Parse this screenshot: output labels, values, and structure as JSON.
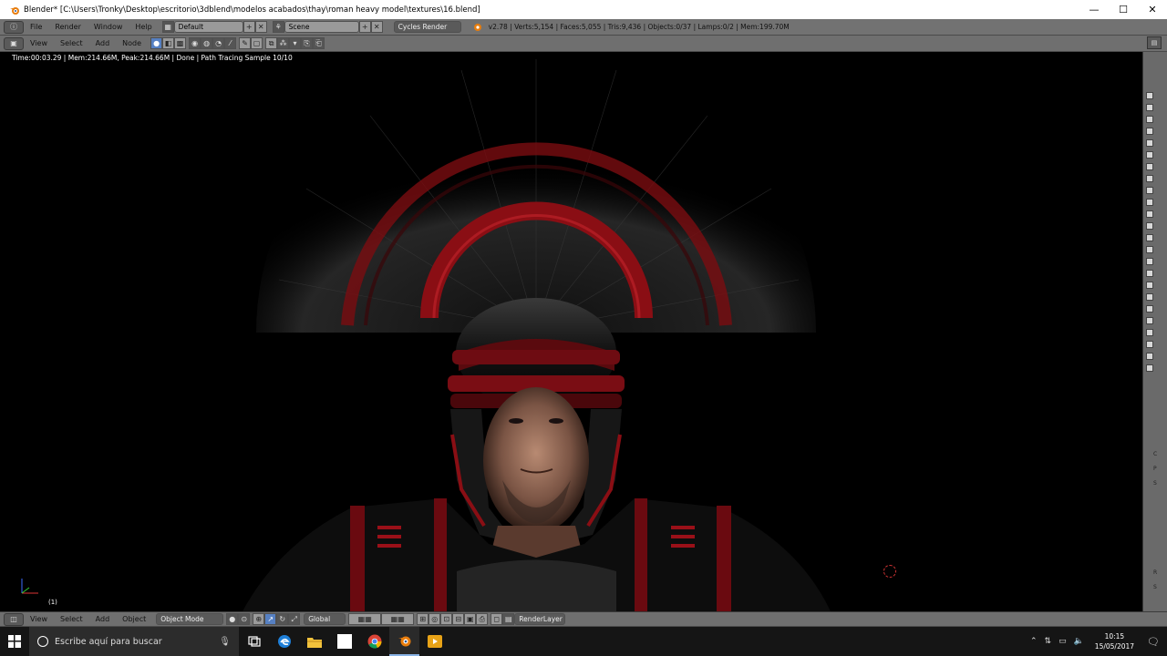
{
  "window": {
    "title": "Blender* [C:\\Users\\Tronky\\Desktop\\escritorio\\3dblend\\modelos acabados\\thay\\roman heavy model\\textures\\16.blend]",
    "minimize": "—",
    "maximize": "☐",
    "close": "✕"
  },
  "info_bar": {
    "menus": [
      "File",
      "Render",
      "Window",
      "Help"
    ],
    "screen_layout": "Default",
    "scene": "Scene",
    "engine": "Cycles Render",
    "stats": "v2.78 | Verts:5,154 | Faces:5,055 | Tris:9,436 | Objects:0/37 | Lamps:0/2 | Mem:199.70M"
  },
  "node_header": {
    "menus": [
      "View",
      "Select",
      "Add",
      "Node"
    ]
  },
  "viewport": {
    "render_status": "Time:00:03.29 | Mem:214.66M, Peak:214.66M | Done | Path Tracing Sample 10/10",
    "frame": "(1)"
  },
  "bottom_header": {
    "menus": [
      "View",
      "Select",
      "Add",
      "Object"
    ],
    "mode": "Object Mode",
    "orientation": "Global",
    "render_layer": "RenderLayer"
  },
  "side_panel": {
    "labels": [
      "C",
      "P",
      "S",
      "R",
      "S"
    ]
  },
  "taskbar": {
    "search_placeholder": "Escribe aquí para buscar",
    "time": "10:15",
    "date": "15/05/2017"
  },
  "colors": {
    "blender_header": "#727272",
    "viewport_bg": "#000000",
    "taskbar": "#151515",
    "accent_red": "#c4141c"
  }
}
